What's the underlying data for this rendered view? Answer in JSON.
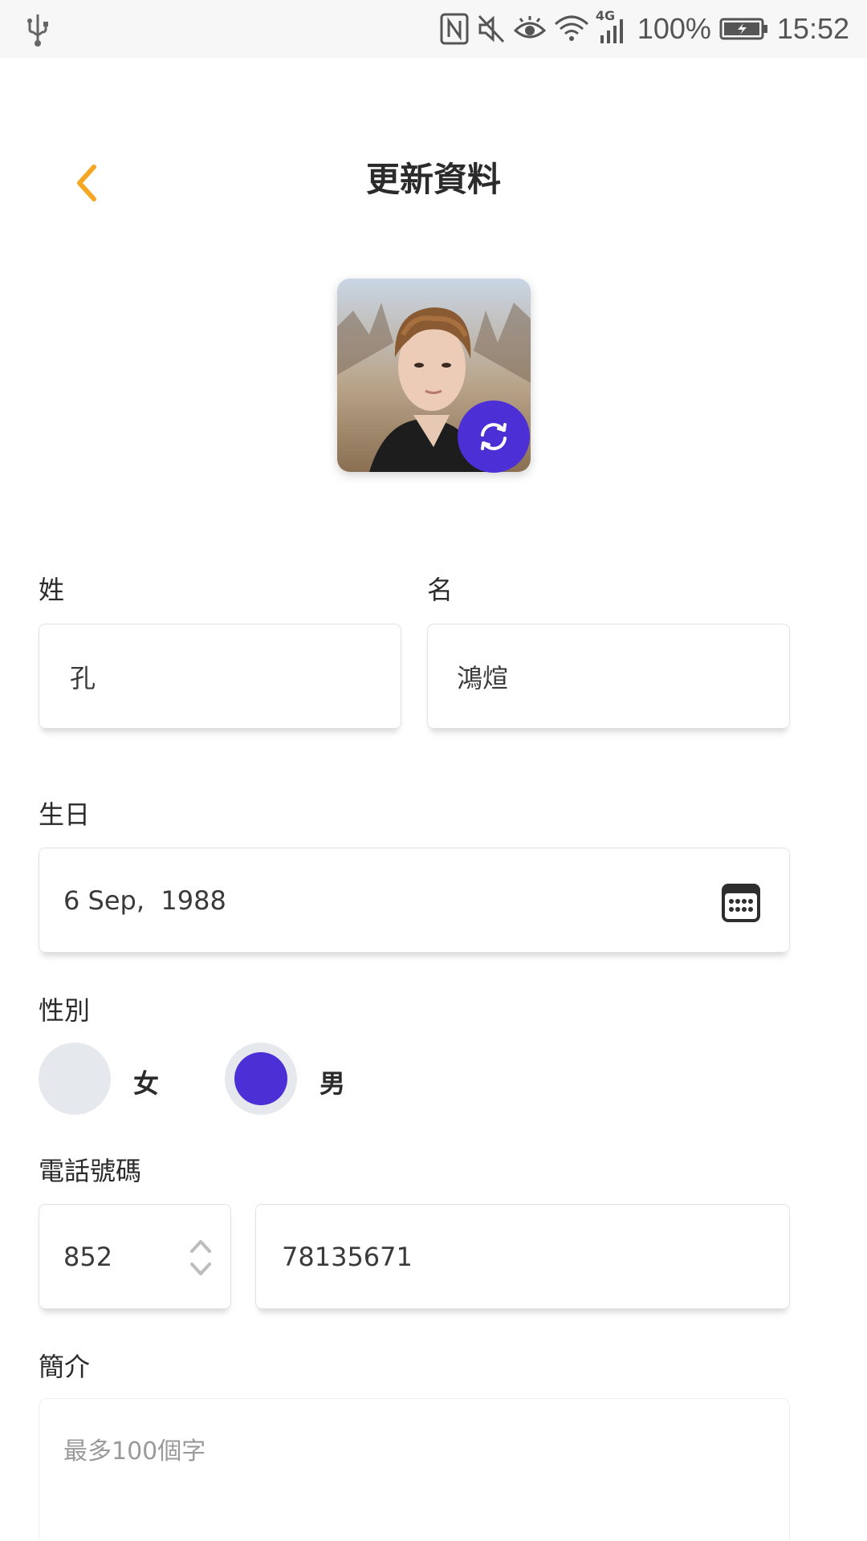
{
  "status_bar": {
    "icons": [
      "usb-icon",
      "nfc-icon",
      "mute-icon",
      "eye-icon",
      "wifi-icon",
      "signal-icon",
      "battery-icon"
    ],
    "network": "4G",
    "battery": "100%",
    "time": "15:52"
  },
  "header": {
    "title": "更新資料",
    "back_icon": "chevron-left-icon"
  },
  "colors": {
    "accent": "#4d2fd6",
    "back_arrow": "#f5a623",
    "radio_bg": "#e5e8ec"
  },
  "avatar": {
    "change_icon": "refresh-icon"
  },
  "form": {
    "last_name": {
      "label": "姓",
      "value": "孔"
    },
    "first_name": {
      "label": "名",
      "value": "鴻煊"
    },
    "birthday": {
      "label": "生日",
      "value": "6 Sep,  1988",
      "icon": "calendar-icon"
    },
    "gender": {
      "label": "性別",
      "options": [
        {
          "label": "女",
          "selected": false
        },
        {
          "label": "男",
          "selected": true
        }
      ]
    },
    "phone": {
      "label": "電話號碼",
      "country_code": "852",
      "number": "78135671",
      "stepper_icon": "up-down-chevron-icon"
    },
    "bio": {
      "label": "簡介",
      "placeholder": "最多100個字"
    }
  }
}
